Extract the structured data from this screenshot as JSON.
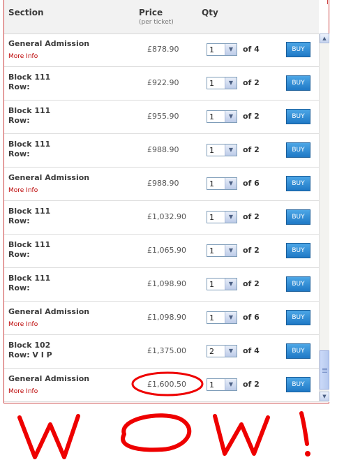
{
  "header": {
    "section": "Section",
    "price": "Price",
    "price_sub": "(per ticket)",
    "qty": "Qty"
  },
  "rows": [
    {
      "line1": "General Admission",
      "line2": "",
      "more": "More Info",
      "price": "£878.90",
      "qty": "1",
      "of": "of 4",
      "buy": "BUY"
    },
    {
      "line1": "Block 111",
      "line2": "Row:",
      "more": "",
      "price": "£922.90",
      "qty": "1",
      "of": "of 2",
      "buy": "BUY"
    },
    {
      "line1": "Block 111",
      "line2": "Row:",
      "more": "",
      "price": "£955.90",
      "qty": "1",
      "of": "of 2",
      "buy": "BUY"
    },
    {
      "line1": "Block 111",
      "line2": "Row:",
      "more": "",
      "price": "£988.90",
      "qty": "1",
      "of": "of 2",
      "buy": "BUY"
    },
    {
      "line1": "General Admission",
      "line2": "",
      "more": "More Info",
      "price": "£988.90",
      "qty": "1",
      "of": "of 6",
      "buy": "BUY"
    },
    {
      "line1": "Block 111",
      "line2": "Row:",
      "more": "",
      "price": "£1,032.90",
      "qty": "1",
      "of": "of 2",
      "buy": "BUY"
    },
    {
      "line1": "Block 111",
      "line2": "Row:",
      "more": "",
      "price": "£1,065.90",
      "qty": "1",
      "of": "of 2",
      "buy": "BUY"
    },
    {
      "line1": "Block 111",
      "line2": "Row:",
      "more": "",
      "price": "£1,098.90",
      "qty": "1",
      "of": "of 2",
      "buy": "BUY"
    },
    {
      "line1": "General Admission",
      "line2": "",
      "more": "More Info",
      "price": "£1,098.90",
      "qty": "1",
      "of": "of 6",
      "buy": "BUY"
    },
    {
      "line1": "Block 102",
      "line2": "Row: V I P",
      "more": "",
      "price": "£1,375.00",
      "qty": "2",
      "of": "of 4",
      "buy": "BUY"
    },
    {
      "line1": "General Admission",
      "line2": "",
      "more": "More Info",
      "price": "£1,600.50",
      "qty": "1",
      "of": "of 2",
      "buy": "BUY"
    }
  ],
  "annotation": {
    "text": "WOW!",
    "color": "#ee0000"
  },
  "colors": {
    "buy_button": "#2f8fd8",
    "more_info": "#bb0000",
    "panel_border": "#cc4444"
  },
  "icons": {
    "dropdown": "chevron-down-icon",
    "scroll_up": "scroll-up-arrow-icon",
    "scroll_down": "scroll-down-arrow-icon"
  }
}
